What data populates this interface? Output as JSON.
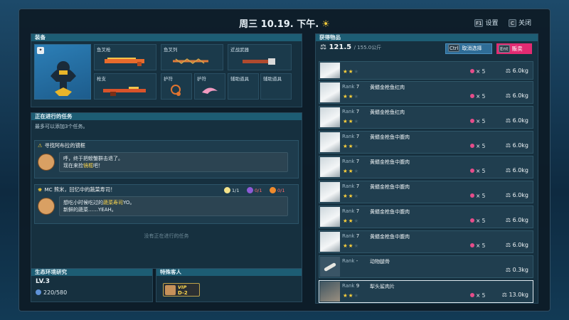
{
  "header": {
    "date_label": "周三 10.19. 下午.",
    "weather_icon": "sun-icon",
    "settings": {
      "key": "F1",
      "label": "设置"
    },
    "close": {
      "key": "C",
      "label": "关闭"
    }
  },
  "equipment": {
    "title": "装备",
    "slots": [
      {
        "label": "鱼叉枪"
      },
      {
        "label": "鱼叉列"
      },
      {
        "label": "近战武器"
      },
      {
        "label": "枪支"
      },
      {
        "label": "护符"
      },
      {
        "label": "护符"
      },
      {
        "label": "辅助道具"
      },
      {
        "label": "辅助道具"
      }
    ]
  },
  "tasks": {
    "title": "正在进行的任务",
    "note": "最多可以添加3个任务。",
    "task1": {
      "title": "寻找阿布拉的镜框",
      "line1": "呼，终于把螃蟹群击退了。",
      "line2_pre": "现在来捡",
      "line2_hl": "镜框",
      "line2_post": "吧！"
    },
    "task2": {
      "title": "MC 熊米，回忆中的蔬菜寿司！",
      "req1": "1/1",
      "req2": "0/1",
      "req3": "0/1",
      "line1_pre": "想吃小时候吃过的",
      "line1_hl": "蔬菜寿司",
      "line1_post": "YO。",
      "line2": "新鲜的蔬菜……YEAH。"
    },
    "empty": "没有正在进行的任务"
  },
  "ecology": {
    "title": "生态环境研究",
    "level": "LV.3",
    "points": "220/580"
  },
  "guest": {
    "title": "特殊客人",
    "vip_label": "VIP",
    "vip_code": "D-2"
  },
  "loot": {
    "title": "获得物品",
    "weight_value": "121.5",
    "weight_max": "/ 155.0公斤",
    "cancel": {
      "key": "Ctrl",
      "label": "取消选择"
    },
    "sell": {
      "key": "Ent",
      "label": "贩卖"
    },
    "items": [
      {
        "rank": "",
        "name": "",
        "stars": 2,
        "qty": "× 5",
        "weight": "6.0kg"
      },
      {
        "rank": "7",
        "name": "黄鳍金枪鱼红肉",
        "stars": 2,
        "qty": "× 5",
        "weight": "6.0kg"
      },
      {
        "rank": "7",
        "name": "黄鳍金枪鱼红肉",
        "stars": 2,
        "qty": "× 5",
        "weight": "6.0kg"
      },
      {
        "rank": "7",
        "name": "黄鳍金枪鱼中腹肉",
        "stars": 2,
        "qty": "× 5",
        "weight": "6.0kg"
      },
      {
        "rank": "7",
        "name": "黄鳍金枪鱼中腹肉",
        "stars": 2,
        "qty": "× 5",
        "weight": "6.0kg"
      },
      {
        "rank": "7",
        "name": "黄鳍金枪鱼中腹肉",
        "stars": 2,
        "qty": "× 5",
        "weight": "6.0kg"
      },
      {
        "rank": "7",
        "name": "黄鳍金枪鱼中腹肉",
        "stars": 2,
        "qty": "× 5",
        "weight": "6.0kg"
      },
      {
        "rank": "7",
        "name": "黄鳍金枪鱼中腹肉",
        "stars": 2,
        "qty": "× 5",
        "weight": "6.0kg"
      },
      {
        "rank": "-",
        "name": "动物腿骨",
        "stars": 0,
        "qty": "",
        "weight": "0.3kg"
      },
      {
        "rank": "9",
        "name": "犁头鲨肉片",
        "stars": 2,
        "qty": "× 5",
        "weight": "13.0kg"
      }
    ]
  }
}
